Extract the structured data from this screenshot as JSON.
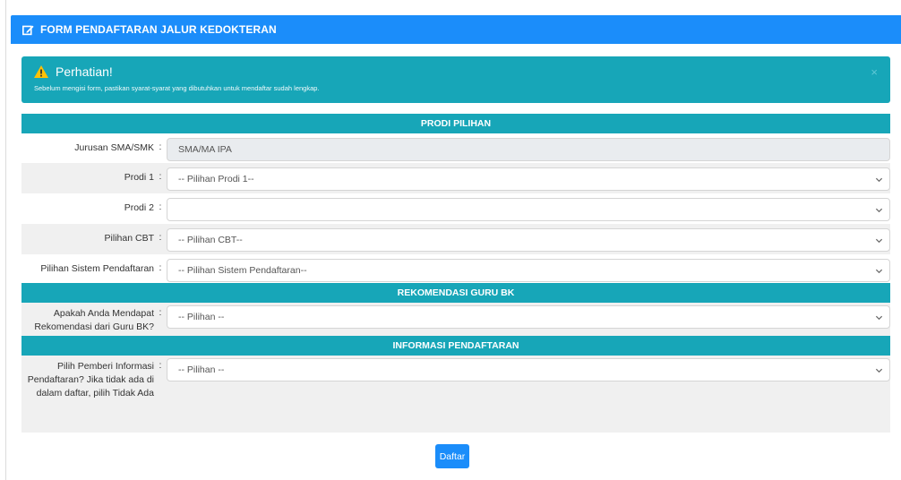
{
  "card": {
    "title": "FORM PENDAFTARAN JALUR KEDOKTERAN",
    "header_color": "#1b8dfa"
  },
  "alert": {
    "title": "Perhatian!",
    "message": "Sebelum mengisi form, pastikan syarat-syarat yang dibutuhkan untuk mendaftar sudah lengkap.",
    "close": "×",
    "color": "#17a6b8"
  },
  "sections": {
    "prodi": "PRODI PILIHAN",
    "rekomendasi": "REKOMENDASI GURU BK",
    "informasi": "INFORMASI PENDAFTARAN"
  },
  "fields": {
    "jurusan": {
      "label": "Jurusan SMA/SMK",
      "value": "SMA/MA  IPA"
    },
    "prodi1": {
      "label": "Prodi 1",
      "value": "-- Pilihan Prodi 1--"
    },
    "prodi2": {
      "label": "Prodi 2",
      "value": ""
    },
    "cbt": {
      "label": "Pilihan CBT",
      "value": "-- Pilihan CBT--"
    },
    "sistem": {
      "label": "Pilihan Sistem Pendaftaran",
      "value": "-- Pilihan Sistem Pendaftaran--"
    },
    "rekomendasi": {
      "label": "Apakah Anda Mendapat Rekomendasi dari Guru BK?",
      "value": "-- Pilihan --"
    },
    "informasi": {
      "label": "Pilih Pemberi Informasi Pendaftaran? Jika tidak ada di dalam daftar, pilih Tidak Ada",
      "value": "-- Pilihan --"
    }
  },
  "colon": ":",
  "submit_label": "Daftar",
  "icons": {
    "header": "edit-icon",
    "alert": "warning-icon",
    "select": "chevron-down-icon"
  }
}
